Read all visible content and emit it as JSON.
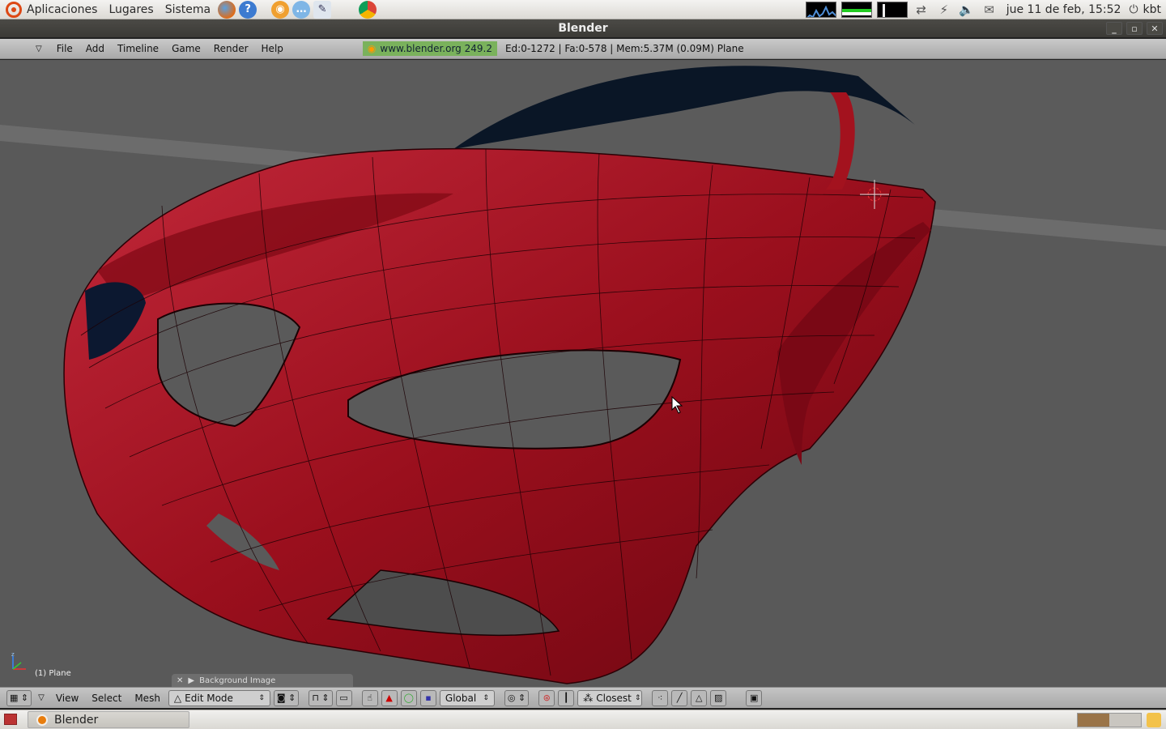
{
  "top_panel": {
    "menus": [
      "Aplicaciones",
      "Lugares",
      "Sistema"
    ],
    "launchers": [
      "firefox-icon",
      "help-icon",
      "blender-icon",
      "empathy-icon",
      "text-editor-icon",
      "chrome-icon"
    ],
    "clock": "jue 11 de feb, 15:52",
    "user": "kbt"
  },
  "window": {
    "title": "Blender"
  },
  "blender_header": {
    "menus": [
      "File",
      "Add",
      "Timeline",
      "Game",
      "Render",
      "Help"
    ],
    "version": "www.blender.org 249.2",
    "stats": "Ed:0-1272 | Fa:0-578 | Mem:5.37M (0.09M) Plane"
  },
  "viewport": {
    "object_label": "(1) Plane",
    "background_panel_label": "Background Image",
    "model_color": "#a3121e"
  },
  "view_header": {
    "menus": [
      "View",
      "Select",
      "Mesh"
    ],
    "mode": "Edit Mode",
    "orientation": "Global",
    "snap": "Closest"
  },
  "taskbar": {
    "task": "Blender"
  }
}
